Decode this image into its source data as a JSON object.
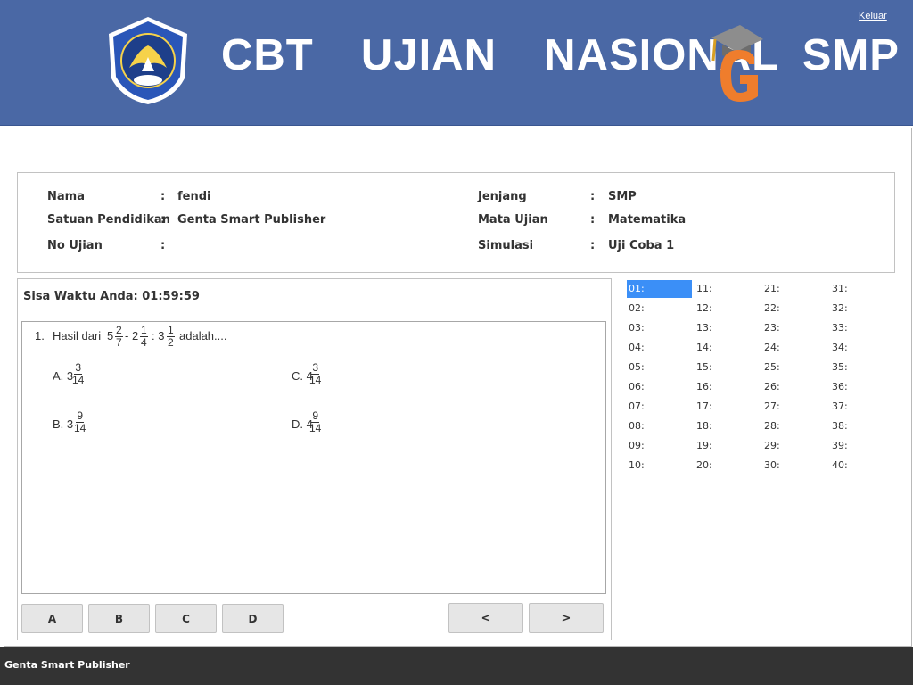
{
  "header": {
    "title": "CBT  UJIAN  NASIONAL SMP",
    "logout_label": "Keluar",
    "logo_text": "TUT WURI HANDAYANI"
  },
  "info": {
    "left": [
      {
        "label": "Nama",
        "value": "fendi"
      },
      {
        "label": "Satuan Pendidikan",
        "value": "Genta Smart Publisher"
      },
      {
        "label": "No Ujian",
        "value": ""
      }
    ],
    "right": [
      {
        "label": "Jenjang",
        "value": "SMP"
      },
      {
        "label": "Mata Ujian",
        "value": "Matematika"
      },
      {
        "label": "Simulasi",
        "value": "Uji Coba 1"
      }
    ],
    "separator": ":"
  },
  "timer": "Sisa Waktu Anda: 01:59:59",
  "question": {
    "number": "1.",
    "intro": "Hasil dari",
    "term1_whole": "5",
    "term1_num": "2",
    "term1_den": "7",
    "op1": "- 2",
    "term2_num": "1",
    "term2_den": "4",
    "op2": ": 3",
    "term3_num": "1",
    "term3_den": "2",
    "outro": "adalah....",
    "options": [
      {
        "label": "A. 3",
        "num": "3",
        "den": "14"
      },
      {
        "label": "B. 3",
        "num": "9",
        "den": "14"
      },
      {
        "label": "C. 4",
        "num": "3",
        "den": "14"
      },
      {
        "label": "D. 4",
        "num": "9",
        "den": "14"
      }
    ]
  },
  "answer_buttons": [
    "A",
    "B",
    "C",
    "D"
  ],
  "nav": {
    "prev": "<",
    "next": ">"
  },
  "question_grid": {
    "items": [
      "01:",
      "02:",
      "03:",
      "04:",
      "05:",
      "06:",
      "07:",
      "08:",
      "09:",
      "10:",
      "11:",
      "12:",
      "13:",
      "14:",
      "15:",
      "16:",
      "17:",
      "18:",
      "19:",
      "20:",
      "21:",
      "22:",
      "23:",
      "24:",
      "25:",
      "26:",
      "27:",
      "28:",
      "29:",
      "30:",
      "31:",
      "32:",
      "33:",
      "34:",
      "35:",
      "36:",
      "37:",
      "38:",
      "39:",
      "40:"
    ],
    "active_index": 0,
    "active_color": "#3b8ff7"
  },
  "footer": "Genta Smart Publisher",
  "colors": {
    "header_bg": "#4a68a5",
    "footer_bg": "#333333"
  }
}
